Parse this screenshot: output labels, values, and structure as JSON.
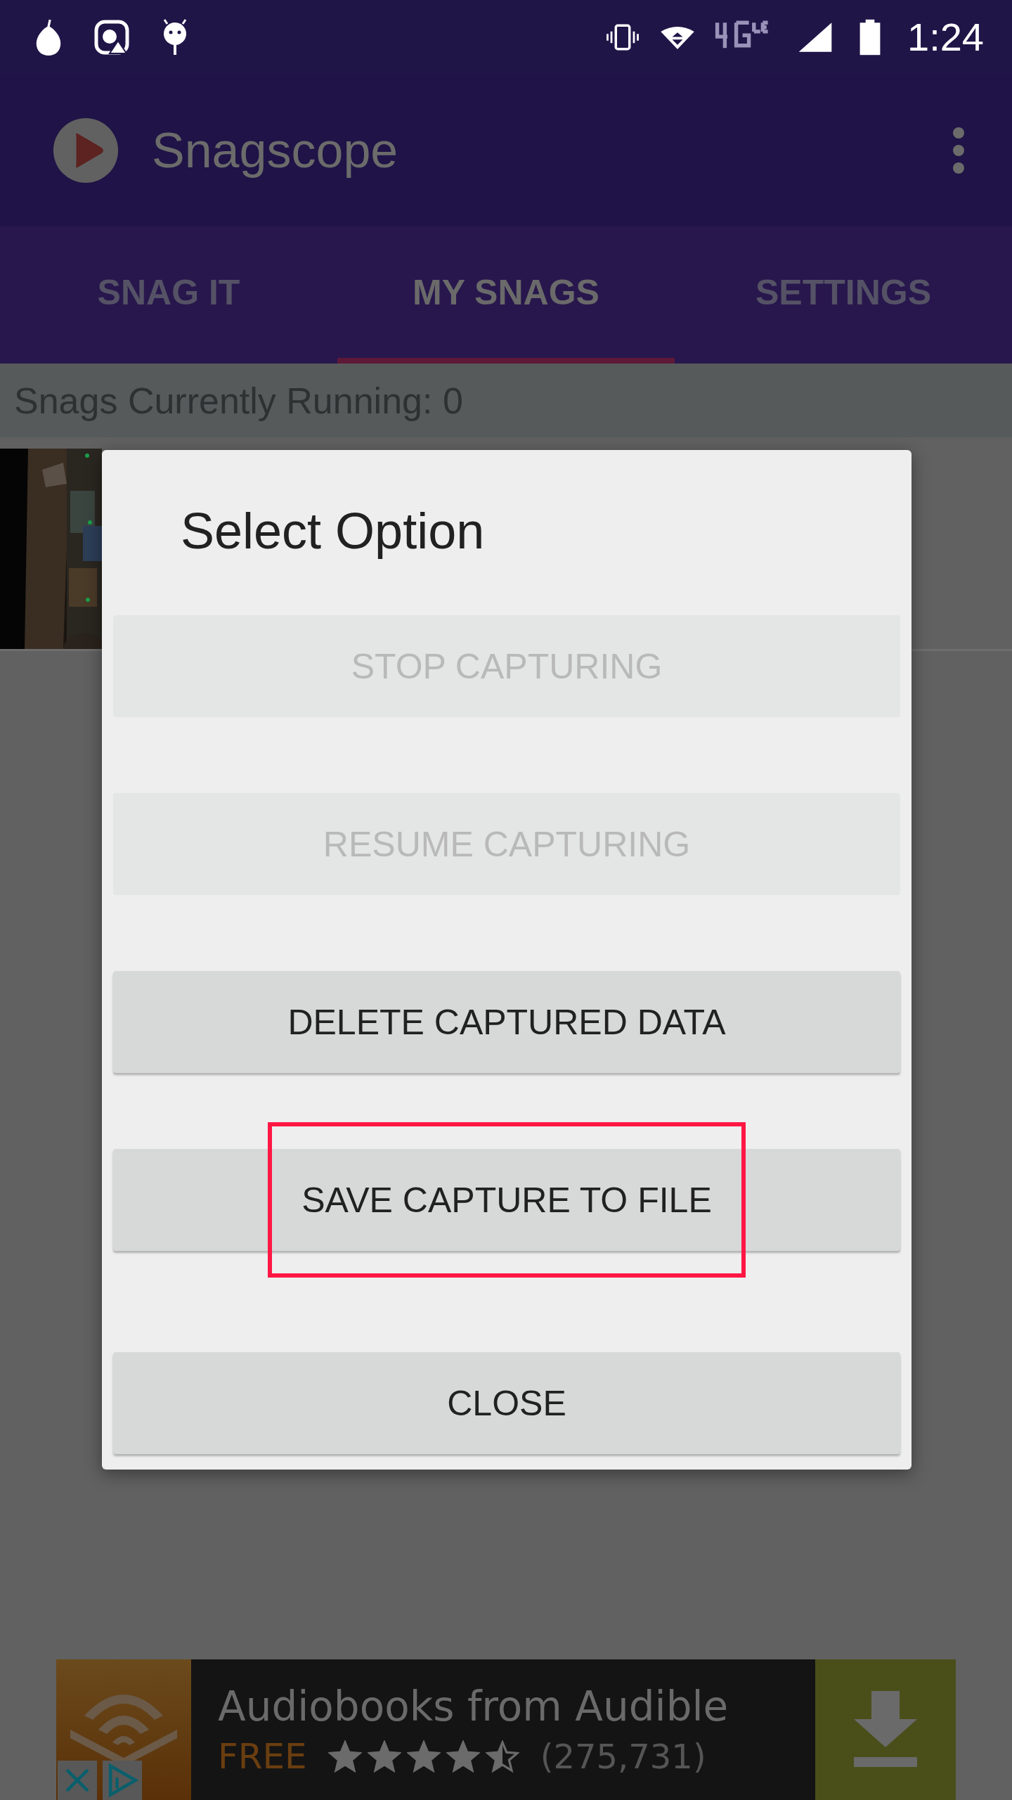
{
  "status_bar": {
    "time": "1:24"
  },
  "app_bar": {
    "title": "Snagscope"
  },
  "tabs": [
    {
      "label": "SNAG IT",
      "selected": false
    },
    {
      "label": "MY SNAGS",
      "selected": true
    },
    {
      "label": "SETTINGS",
      "selected": false
    }
  ],
  "header": {
    "text": "Snags Currently Running: 0"
  },
  "dialog": {
    "title": "Select Option",
    "options": [
      {
        "label": "STOP CAPTURING",
        "disabled": true,
        "highlighted": false
      },
      {
        "label": "RESUME CAPTURING",
        "disabled": true,
        "highlighted": false
      },
      {
        "label": "DELETE CAPTURED DATA",
        "disabled": false,
        "highlighted": false
      },
      {
        "label": "SAVE CAPTURE TO FILE",
        "disabled": false,
        "highlighted": true
      },
      {
        "label": "CLOSE",
        "disabled": false,
        "highlighted": false
      }
    ]
  },
  "ad": {
    "title": "Audiobooks from Audible",
    "price": "FREE",
    "stars": 4.5,
    "reviews": "(275,731)"
  }
}
